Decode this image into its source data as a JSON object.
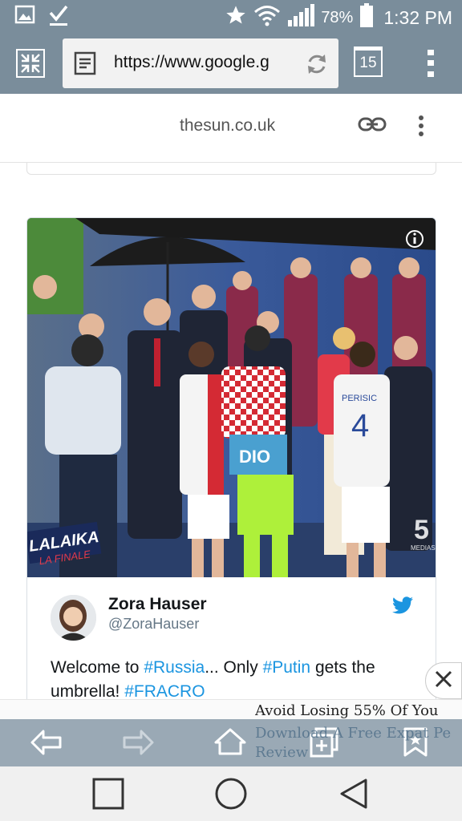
{
  "status_bar": {
    "battery_percent": "78%",
    "time": "1:32 PM",
    "icons": [
      "image-icon",
      "check-download-icon",
      "star-icon",
      "wifi-icon",
      "signal-icon",
      "battery-icon"
    ]
  },
  "browser": {
    "url": "https://www.google.g",
    "tab_count": "15"
  },
  "site": {
    "domain": "thesun.co.uk"
  },
  "tweet": {
    "author_name": "Zora Hauser",
    "author_handle": "@ZoraHauser",
    "text_before": "Welcome to ",
    "hashtag_russia": "#Russia",
    "text_mid": "... Only ",
    "hashtag_putin": "#Putin",
    "text_after": " gets the umbrella! ",
    "hashtag_fracro": "#FRACRO",
    "media": {
      "shirt_name": "PERISIC",
      "shirt_number": "4",
      "jacket_text": "DIO",
      "banner_text": "LALAIKA",
      "banner_sub": "LA FINALE",
      "channel_logo": "5",
      "channel_name": "MEDIASET"
    }
  },
  "ad": {
    "headline": "Avoid Losing 55% Of You",
    "subline": "Download A Free Expat Pe Review"
  },
  "colors": {
    "bar": "#7a8d9b",
    "twitter_blue": "#1b95e0"
  }
}
